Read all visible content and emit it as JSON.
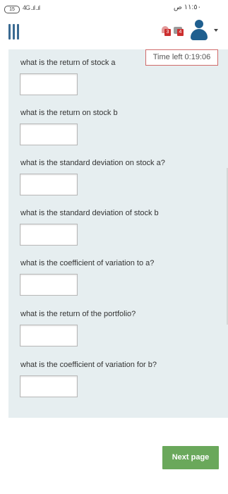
{
  "status_bar": {
    "battery": "15",
    "signal": "4G ..ıl ..ıl",
    "time": "١١:٥٠ ص"
  },
  "header": {
    "notification_count": "3",
    "message_count": "4"
  },
  "timer": {
    "label": "Time left 0:19:06"
  },
  "questions": [
    {
      "text": "what is the return of stock a",
      "value": ""
    },
    {
      "text": "what is the return on stock b",
      "value": ""
    },
    {
      "text": "what is the standard deviation on stock a?",
      "value": ""
    },
    {
      "text": "what is the standard deviation of stock b",
      "value": ""
    },
    {
      "text": "what is the coefficient of variation to a?",
      "value": ""
    },
    {
      "text": "what is the return of the portfolio?",
      "value": ""
    },
    {
      "text": "what is the coefficient of variation for b?",
      "value": ""
    }
  ],
  "footer": {
    "next_label": "Next page"
  },
  "colors": {
    "panel": "#e6eef0",
    "accent_blue": "#1f5f8f",
    "next_button": "#6aa85b",
    "timer_border": "#d06a6a",
    "badge": "#cc2f2f"
  }
}
